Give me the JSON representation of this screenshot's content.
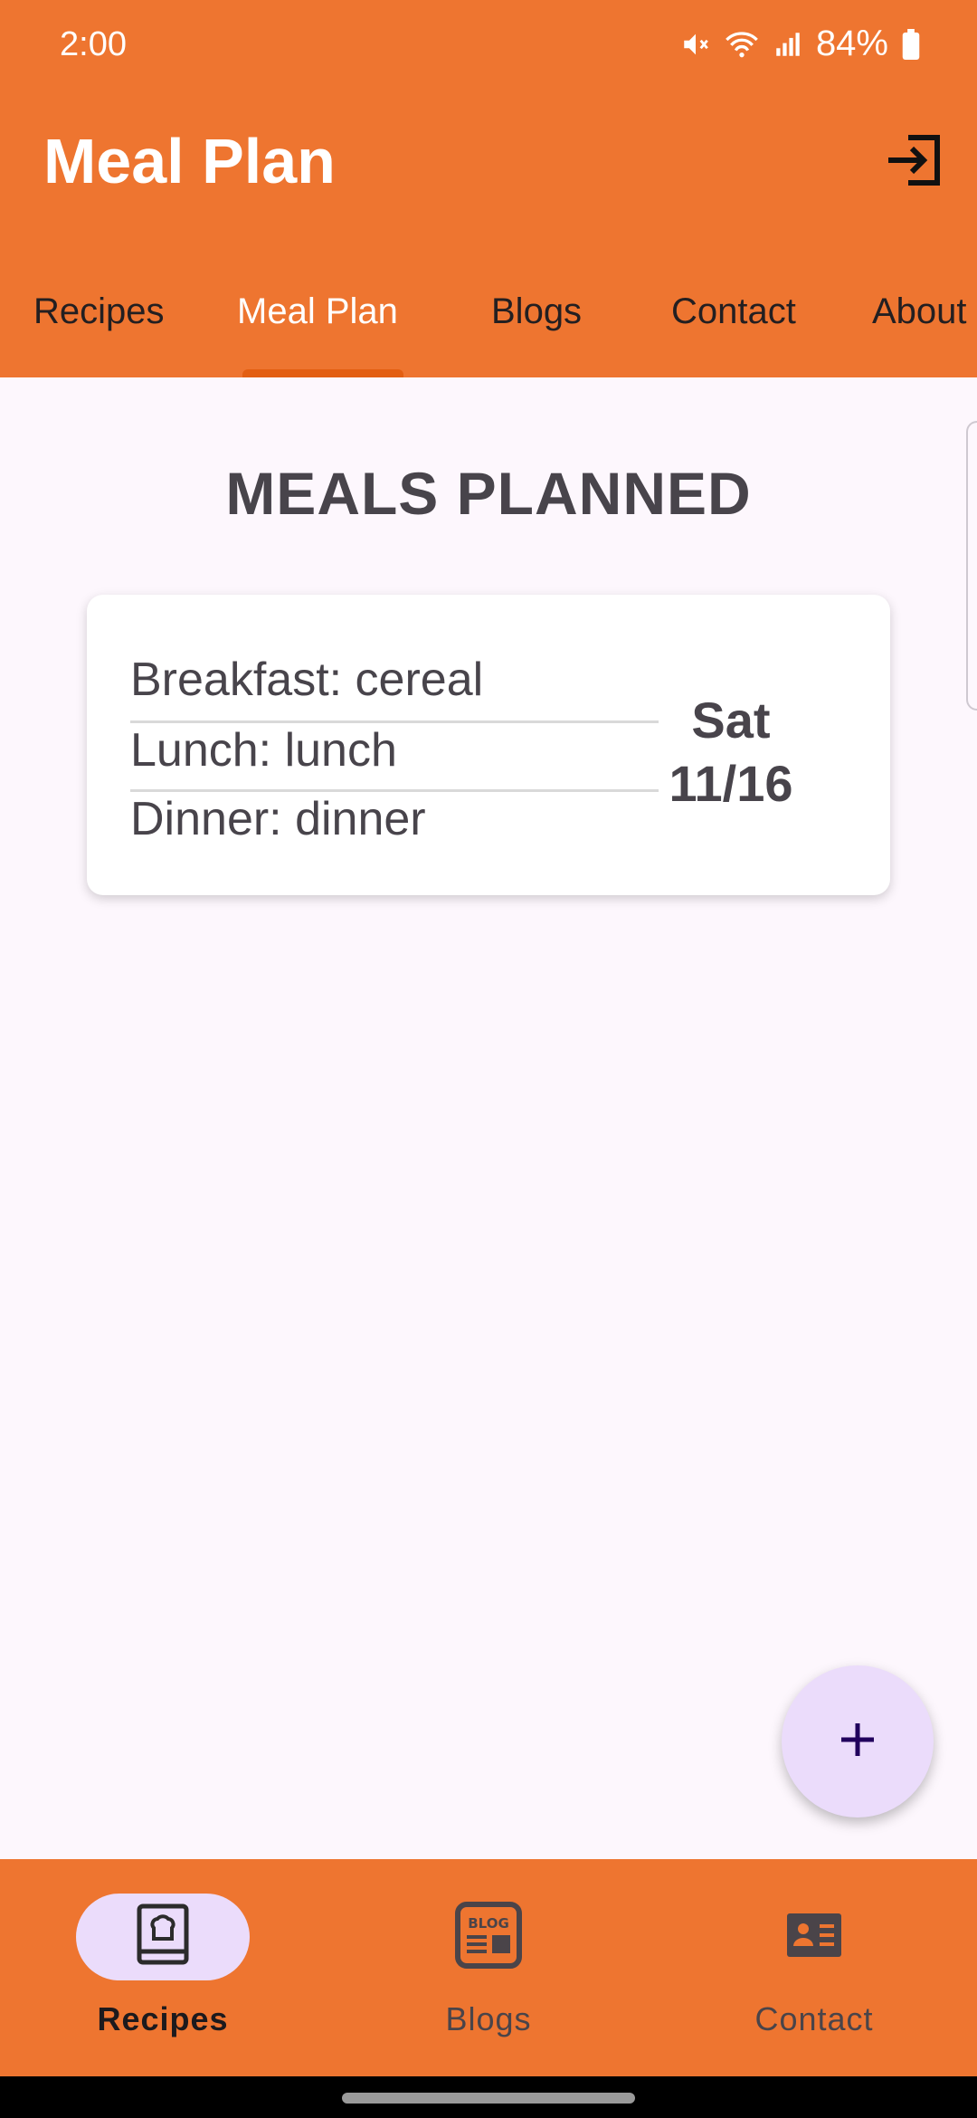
{
  "status_bar": {
    "time": "2:00",
    "battery": "84%",
    "icons": [
      "mute-icon",
      "wifi-icon",
      "signal-icon",
      "battery-icon"
    ]
  },
  "header": {
    "title": "Meal Plan",
    "logout_icon": "logout-icon"
  },
  "tabs": [
    {
      "label": "Recipes"
    },
    {
      "label": "Meal Plan"
    },
    {
      "label": "Blogs"
    },
    {
      "label": "Contact"
    },
    {
      "label": "About"
    }
  ],
  "active_tab": "Meal Plan",
  "main": {
    "heading": "MEALS PLANNED",
    "plans": [
      {
        "breakfast": "Breakfast: cereal",
        "lunch": "Lunch: lunch",
        "dinner": "Dinner: dinner",
        "day": "Sat",
        "date": "11/16"
      }
    ]
  },
  "fab": {
    "icon": "plus-icon"
  },
  "bottom_nav": [
    {
      "label": "Recipes",
      "icon": "recipe-book-icon"
    },
    {
      "label": "Blogs",
      "icon": "blog-icon"
    },
    {
      "label": "Contact",
      "icon": "contact-card-icon"
    }
  ],
  "colors": {
    "primary": "#ee7530",
    "tab_indicator": "#e35f12",
    "background": "#fdf7fd",
    "fab": "#ebdcfb",
    "text_dark": "#48444b"
  }
}
